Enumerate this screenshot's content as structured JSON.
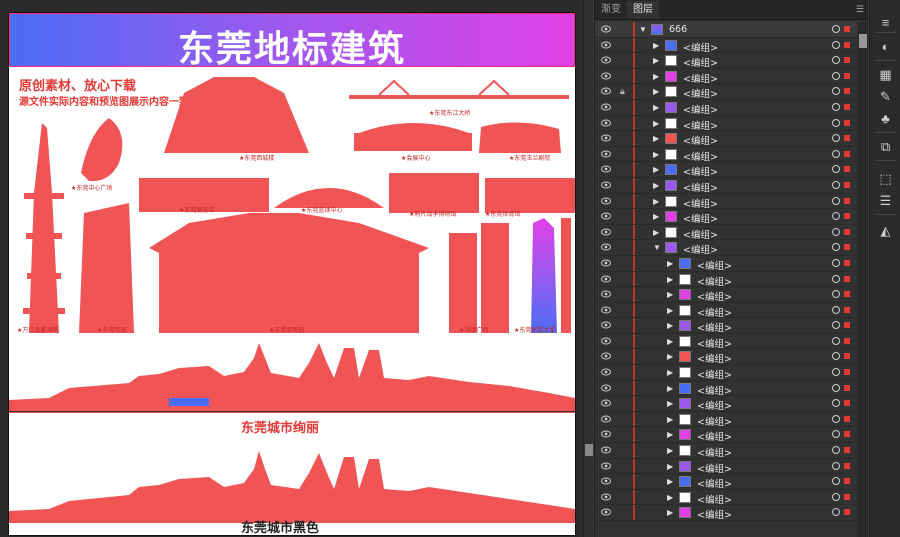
{
  "artboard": {
    "title": "东莞地标建筑",
    "note_line1": "原创素材、放心下载",
    "note_line2": "源文件实际内容和预览图展示内容一致",
    "captions": [
      "★东莞中心广场",
      "★东莞西城楼",
      "★东莞东江大桥",
      "★会展中心",
      "★东莞玉兰剧院",
      "★东莞展览馆",
      "★东莞篮球中心",
      "★鸦片战争博物馆",
      "★东莞体育馆",
      "★万江金鳌洲塔",
      "★东莞可园",
      "★东莞粤晖园",
      "★海德广场",
      "★东莞高楼大厦"
    ],
    "section1_caption": "东莞城市绚丽",
    "section2_caption": "东莞城市黑色",
    "accent_color": "#f05454",
    "gradient_colors": [
      "#4b6cf5",
      "#9a5af0",
      "#e040e6"
    ]
  },
  "panel": {
    "tabs": [
      "渐变",
      "图层"
    ],
    "active_tab": "图层",
    "top_layer": "666",
    "group_label": "<编组>",
    "rows": [
      {
        "depth": 1,
        "expanded": false,
        "locked": false
      },
      {
        "depth": 1,
        "expanded": false,
        "locked": false
      },
      {
        "depth": 1,
        "expanded": false,
        "locked": false
      },
      {
        "depth": 1,
        "expanded": false,
        "locked": true
      },
      {
        "depth": 1,
        "expanded": false,
        "locked": false
      },
      {
        "depth": 1,
        "expanded": false,
        "locked": false
      },
      {
        "depth": 1,
        "expanded": false,
        "locked": false
      },
      {
        "depth": 1,
        "expanded": false,
        "locked": false
      },
      {
        "depth": 1,
        "expanded": false,
        "locked": false
      },
      {
        "depth": 1,
        "expanded": false,
        "locked": false
      },
      {
        "depth": 1,
        "expanded": false,
        "locked": false
      },
      {
        "depth": 1,
        "expanded": false,
        "locked": false
      },
      {
        "depth": 1,
        "expanded": false,
        "locked": false
      },
      {
        "depth": 1,
        "expanded": true,
        "locked": false
      },
      {
        "depth": 2,
        "expanded": false,
        "locked": false
      },
      {
        "depth": 2,
        "expanded": false,
        "locked": false
      },
      {
        "depth": 2,
        "expanded": false,
        "locked": false
      },
      {
        "depth": 2,
        "expanded": false,
        "locked": false
      },
      {
        "depth": 2,
        "expanded": false,
        "locked": false
      },
      {
        "depth": 2,
        "expanded": false,
        "locked": false
      },
      {
        "depth": 2,
        "expanded": false,
        "locked": false
      },
      {
        "depth": 2,
        "expanded": false,
        "locked": false
      },
      {
        "depth": 2,
        "expanded": false,
        "locked": false
      },
      {
        "depth": 2,
        "expanded": false,
        "locked": false
      },
      {
        "depth": 2,
        "expanded": false,
        "locked": false
      },
      {
        "depth": 2,
        "expanded": false,
        "locked": false
      },
      {
        "depth": 2,
        "expanded": false,
        "locked": false
      },
      {
        "depth": 2,
        "expanded": false,
        "locked": false
      },
      {
        "depth": 2,
        "expanded": false,
        "locked": false
      },
      {
        "depth": 2,
        "expanded": false,
        "locked": false
      },
      {
        "depth": 2,
        "expanded": false,
        "locked": false
      }
    ]
  },
  "toolbar": {
    "icons": [
      "hamburger-icon",
      "color-icon",
      "swatches-icon",
      "brushes-icon",
      "symbols-icon",
      "pathfinder-icon",
      "transform-icon",
      "align-icon",
      "gradient-icon"
    ]
  }
}
